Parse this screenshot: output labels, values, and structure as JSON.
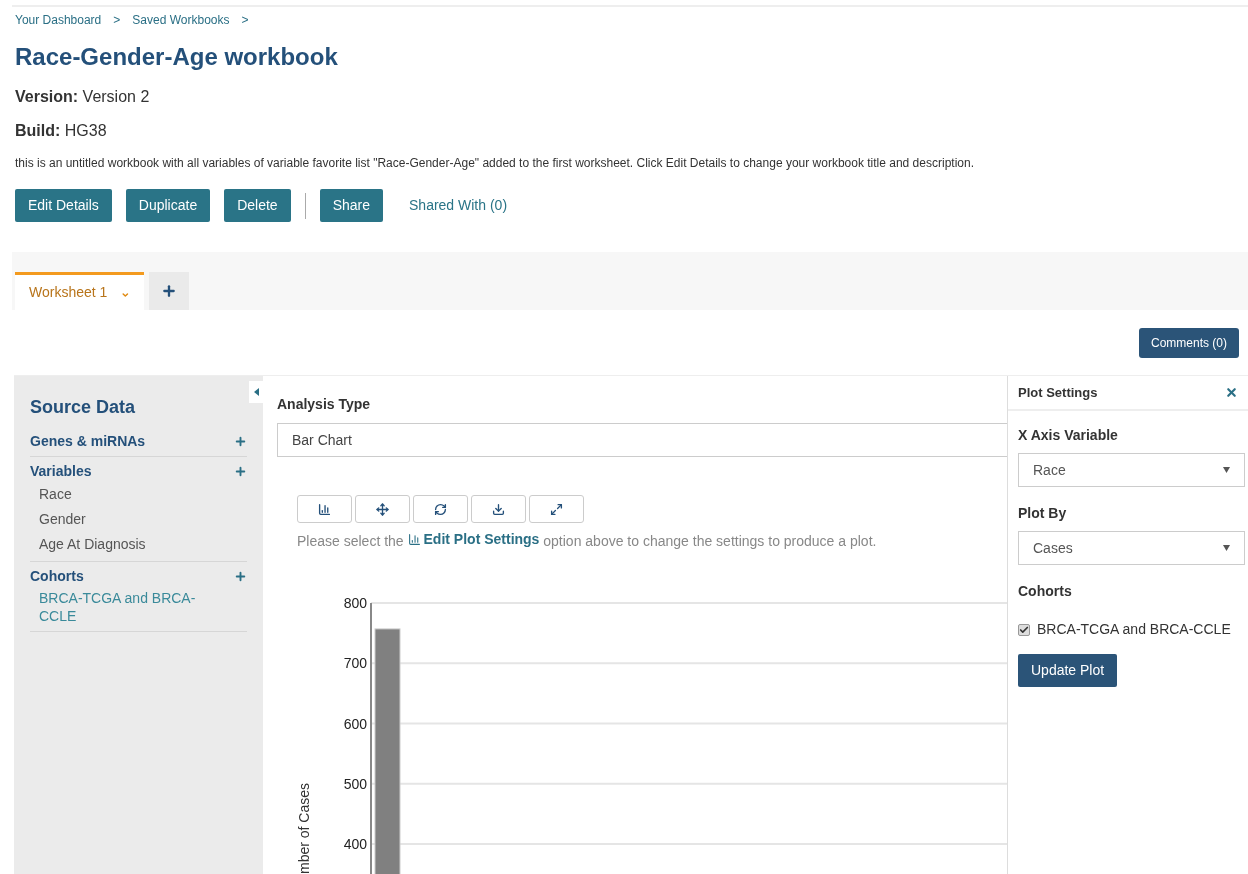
{
  "breadcrumbs": [
    {
      "label": "Your Dashboard",
      "separator": ">"
    },
    {
      "label": "Saved Workbooks",
      "separator": ">"
    }
  ],
  "title": "Race-Gender-Age workbook",
  "meta": [
    {
      "label": "Version:",
      "value": "Version 2"
    },
    {
      "label": "Build:",
      "value": "HG38"
    }
  ],
  "description": "this is an untitled workbook with all variables of variable favorite list \"Race-Gender-Age\" added to the first worksheet. Click Edit Details to change your workbook title and description.",
  "actions": [
    {
      "kind": "button",
      "label": "Edit Details"
    },
    {
      "kind": "button",
      "label": "Duplicate"
    },
    {
      "kind": "button",
      "label": "Delete"
    },
    {
      "kind": "divider"
    },
    {
      "kind": "button",
      "label": "Share"
    },
    {
      "kind": "link",
      "label": "Shared With (0)"
    }
  ],
  "worksheet_tabs": [
    {
      "label": "Worksheet 1",
      "selected": true
    }
  ],
  "comments_button": "Comments (0)",
  "source_data": {
    "title": "Source Data",
    "sections": [
      {
        "title": "Genes & miRNAs"
      },
      {
        "title": "Variables",
        "items": [
          {
            "label": "Race",
            "kind": "variable"
          },
          {
            "label": "Gender",
            "kind": "variable"
          },
          {
            "label": "Age At Diagnosis",
            "kind": "variable"
          }
        ]
      },
      {
        "title": "Cohorts",
        "items": [
          {
            "label": "BRCA-TCGA and BRCA-CCLE",
            "kind": "cohort"
          }
        ]
      }
    ]
  },
  "analysis": {
    "label": "Analysis Type",
    "value": "Bar Chart",
    "hint": {
      "before": "Please select the",
      "link": "Edit Plot Settings",
      "after": "option above to change the settings to produce a plot."
    },
    "chart_data": {
      "type": "bar",
      "ylabel": "mber of Cases",
      "values": [
        757
      ],
      "ylim": [
        337,
        800
      ],
      "grid": true,
      "yticks": [
        400,
        500,
        600,
        700,
        800
      ]
    }
  },
  "plot_settings": {
    "title": "Plot Settings",
    "x_axis": {
      "label": "X Axis Variable",
      "value": "Race"
    },
    "plot_by": {
      "label": "Plot By",
      "value": "Cases"
    },
    "cohorts": {
      "label": "Cohorts",
      "items": [
        {
          "label": "BRCA-TCGA and BRCA-CCLE",
          "checked": true
        }
      ]
    },
    "update_button": "Update Plot"
  }
}
